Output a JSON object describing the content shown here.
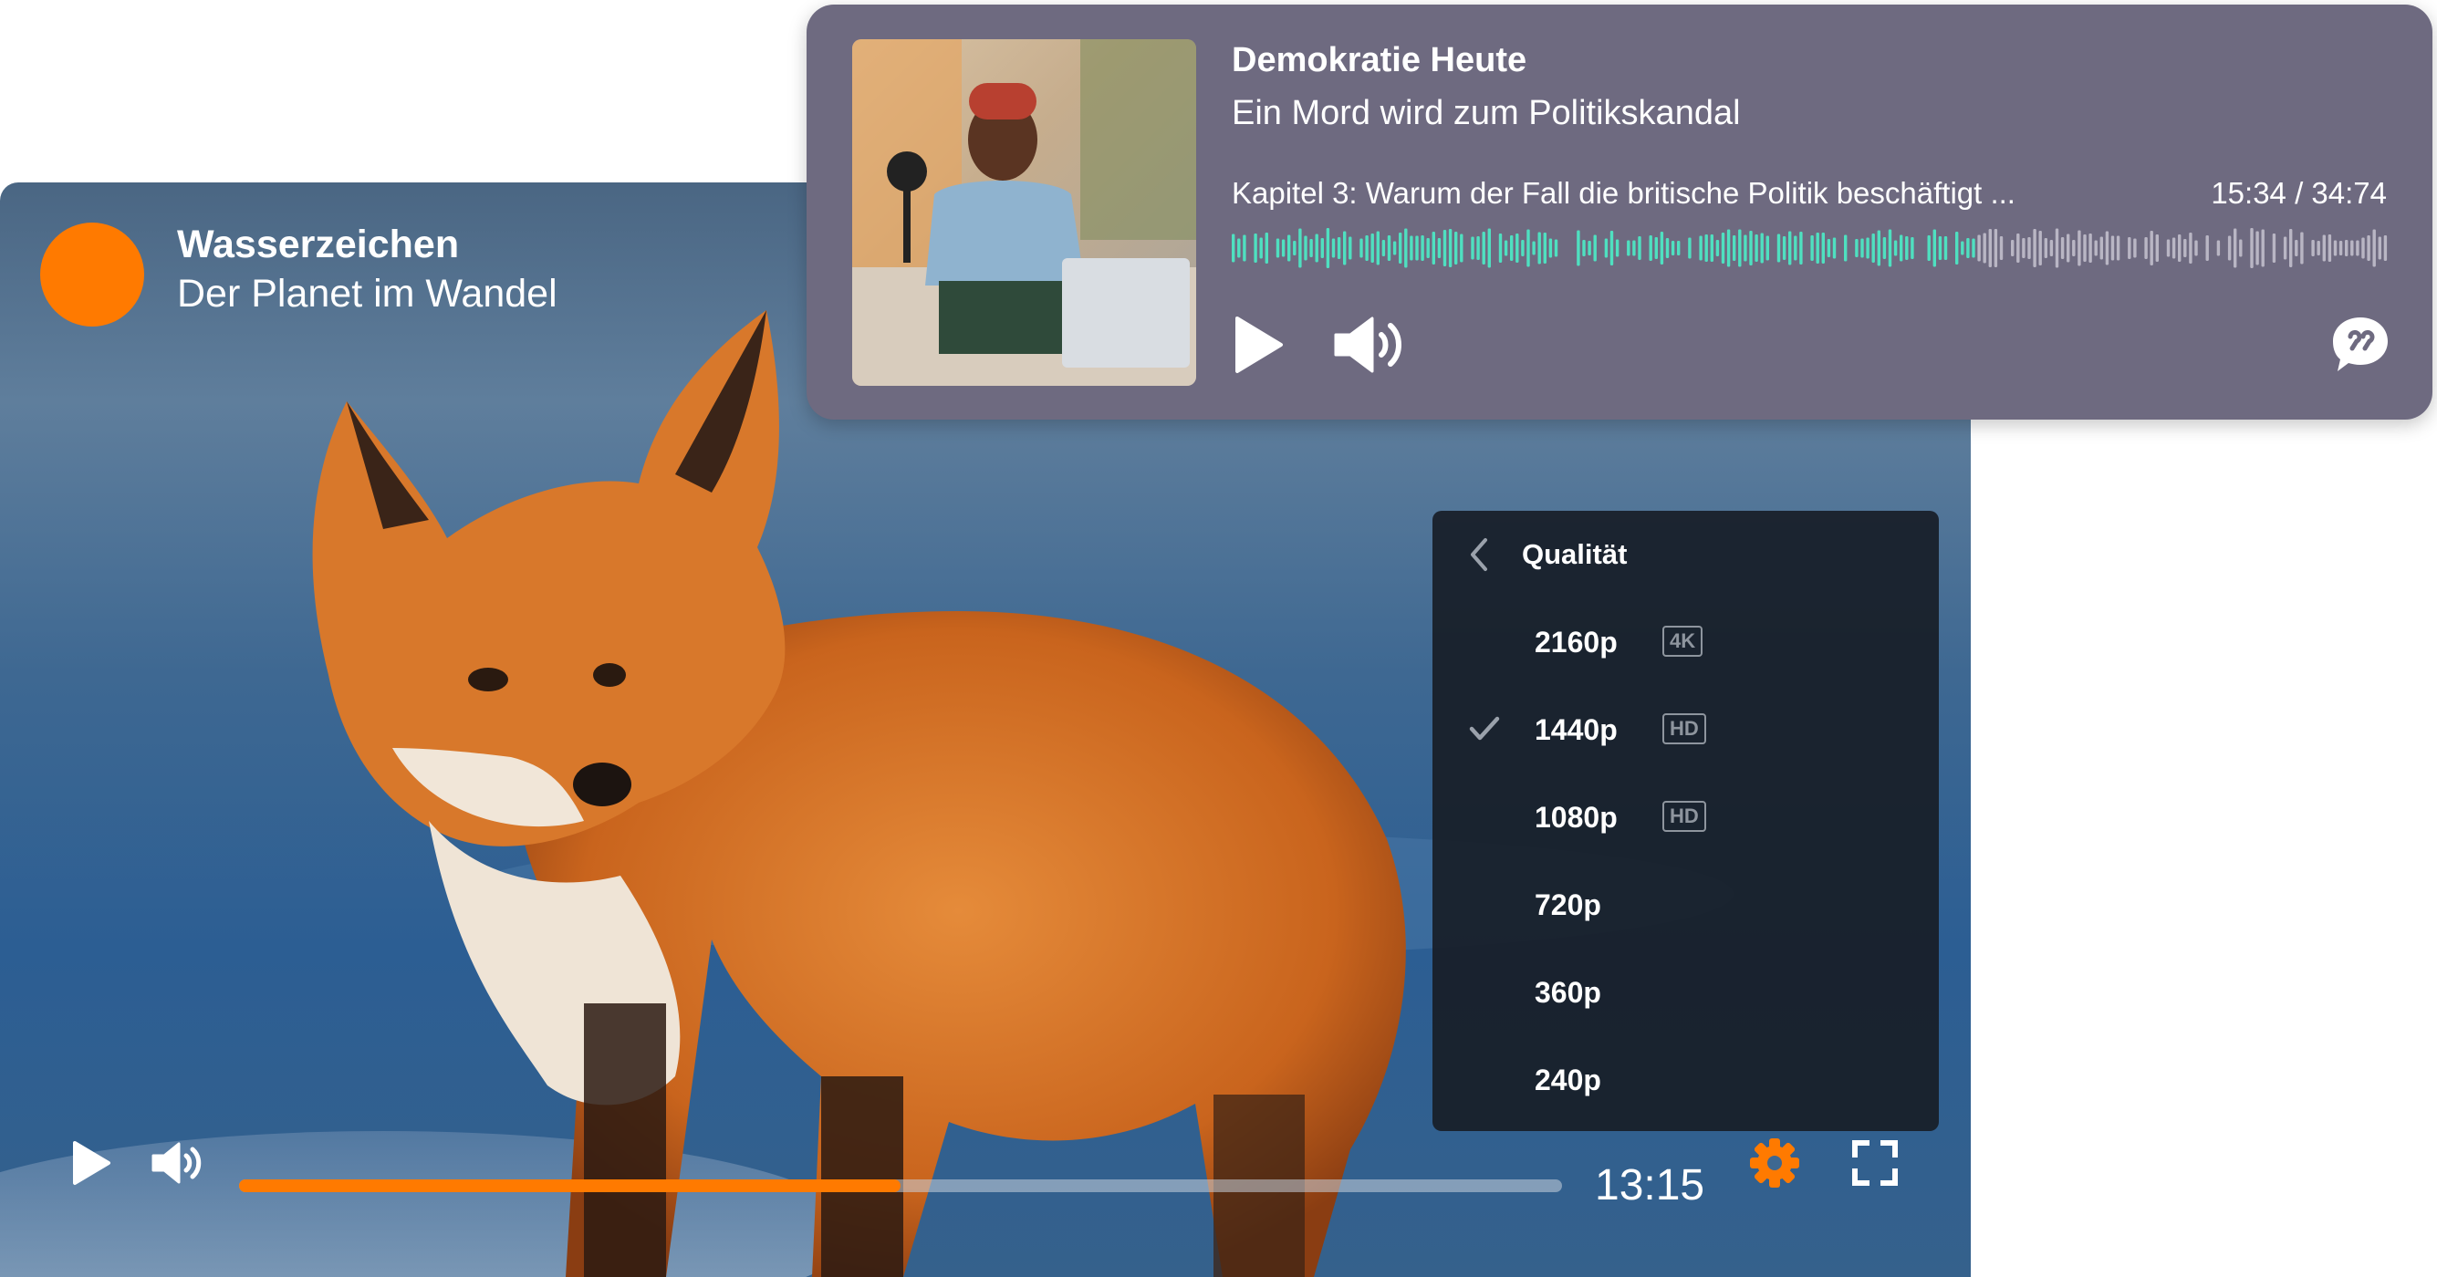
{
  "video_player": {
    "title": "Wasserzeichen",
    "subtitle": "Der Planet im Wandel",
    "current_time": "13:15",
    "progress_fraction": 0.5,
    "accent_color": "#ff7a00",
    "icons": {
      "play": "play-icon",
      "volume": "volume-icon",
      "settings": "gear-icon",
      "fullscreen": "fullscreen-icon"
    },
    "quality_menu": {
      "title": "Qualität",
      "back_icon": "chevron-left-icon",
      "selected": "1440p",
      "options": [
        {
          "label": "2160p",
          "badge": "4K"
        },
        {
          "label": "1440p",
          "badge": "HD"
        },
        {
          "label": "1080p",
          "badge": "HD"
        },
        {
          "label": "720p",
          "badge": ""
        },
        {
          "label": "360p",
          "badge": ""
        },
        {
          "label": "240p",
          "badge": ""
        }
      ]
    }
  },
  "podcast_player": {
    "show_title": "Demokratie Heute",
    "episode_title": "Ein Mord wird zum Politikskandal",
    "chapter": "Kapitel 3: Warum der Fall die britische Politik beschäftigt ...",
    "time": "15:34 / 34:74",
    "played_fraction": 0.64,
    "waveform_played_color": "#4fe0c0",
    "waveform_unplayed_color": "#b9b6c4",
    "icons": {
      "play": "play-icon",
      "volume": "volume-icon",
      "chat": "chat-bubble-icon"
    }
  }
}
